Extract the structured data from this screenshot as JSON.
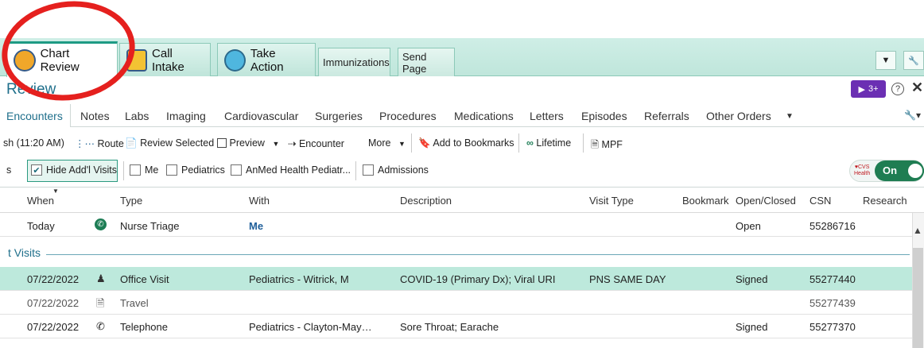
{
  "app_tabs": [
    {
      "label": "Chart Review",
      "active": true
    },
    {
      "label": "Call Intake"
    },
    {
      "label": "Take Action"
    },
    {
      "label": "Immunizations"
    },
    {
      "label": "Send Page"
    }
  ],
  "activity": {
    "title": "Review",
    "badge": "3+"
  },
  "subtabs": [
    "Encounters",
    "Notes",
    "Labs",
    "Imaging",
    "Cardiovascular",
    "Surgeries",
    "Procedures",
    "Medications",
    "Letters",
    "Episodes",
    "Referrals",
    "Other Orders"
  ],
  "toolbar": {
    "refresh": "sh (11:20 AM)",
    "route": "Route",
    "review_selected": "Review Selected",
    "preview": "Preview",
    "encounter": "Encounter",
    "more": "More",
    "add_bookmarks": "Add to Bookmarks",
    "lifetime": "Lifetime",
    "mpf": "MPF"
  },
  "filters": {
    "prefix": "s",
    "hide_addl": "Hide Add'l Visits",
    "me": "Me",
    "pediatrics": "Pediatrics",
    "anmed": "AnMed Health Pediatr...",
    "admissions": "Admissions"
  },
  "cvs_toggle": {
    "brand": "CVS Health",
    "state": "On"
  },
  "columns": [
    "When",
    "Type",
    "With",
    "Description",
    "Visit Type",
    "Bookmark",
    "Open/Closed",
    "CSN",
    "Research"
  ],
  "today_row": {
    "when": "Today",
    "type": "Nurse Triage",
    "with": "Me",
    "status": "Open",
    "csn": "55286716"
  },
  "group_label": "t Visits",
  "rows": [
    {
      "when": "07/22/2022",
      "icon": "person-icon",
      "type": "Office Visit",
      "with": "Pediatrics - Witrick, M",
      "description": "COVID-19 (Primary Dx); Viral URI",
      "visit_type": "PNS SAME DAY",
      "status": "Signed",
      "csn": "55277440"
    },
    {
      "when": "07/22/2022",
      "icon": "document-icon",
      "type": "Travel",
      "with": "",
      "description": "",
      "visit_type": "",
      "status": "",
      "csn": "55277439"
    },
    {
      "when": "07/22/2022",
      "icon": "phone-icon",
      "type": "Telephone",
      "with": "Pediatrics - Clayton-May…",
      "description": "Sore Throat; Earache",
      "visit_type": "",
      "status": "Signed",
      "csn": "55277370"
    }
  ]
}
